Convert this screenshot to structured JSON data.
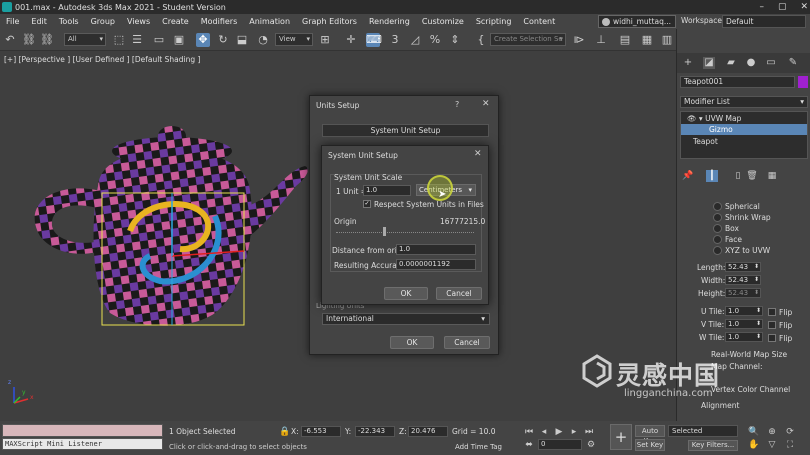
{
  "window": {
    "title": "001.max - Autodesk 3ds Max 2021 - Student Version",
    "controls": [
      "–",
      "▢",
      "✕"
    ]
  },
  "menu": {
    "items": [
      "File",
      "Edit",
      "Tools",
      "Group",
      "Views",
      "Create",
      "Modifiers",
      "Animation",
      "Graph Editors",
      "Rendering",
      "Customize",
      "Scripting",
      "Content"
    ],
    "user": "widhi_muttaq...",
    "workspaces_label": "Workspaces:",
    "workspace": "Default"
  },
  "toolbar": {
    "filter": "All",
    "ref_coord": "View",
    "named_selection": "Create Selection Se"
  },
  "viewport": {
    "label": "[+] [Perspective ] [User Defined ] [Default Shading ]",
    "axis_x": "x",
    "axis_y": "y",
    "axis_z": "z"
  },
  "command_panel": {
    "object_name": "Teapot001",
    "object_color": "#a020d0",
    "modifier_list": "Modifier List",
    "stack": [
      {
        "label": "UVW Map",
        "selected": false
      },
      {
        "label": "Gizmo",
        "selected": true
      },
      {
        "label": "Teapot",
        "selected": false
      }
    ],
    "mapping_options": [
      "Spherical",
      "Shrink Wrap",
      "Box",
      "Face",
      "XYZ to UVW"
    ],
    "length_label": "Length:",
    "length": "52.43",
    "width_label": "Width:",
    "width": "52.43",
    "height_label": "Height:",
    "height": "52.43",
    "utile_label": "U Tile:",
    "utile": "1.0",
    "vtile_label": "V Tile:",
    "vtile": "1.0",
    "wtile_label": "W Tile:",
    "wtile": "1.0",
    "flip": "Flip",
    "real_world": "Real-World Map Size",
    "map_channel": "Map Channel:",
    "vertex_color": "Vertex Color Channel",
    "alignment": "Alignment"
  },
  "units_setup": {
    "title": "Units Setup",
    "help": "?",
    "close": "✕",
    "system_unit_setup_button": "System Unit Setup",
    "lighting_label": "Lighting Units",
    "lighting_value": "International",
    "ok": "OK",
    "cancel": "Cancel"
  },
  "system_unit_setup": {
    "title": "System Unit Setup",
    "close": "✕",
    "scale_label": "System Unit Scale",
    "unit_label": "1 Unit =",
    "unit_value": "1.0",
    "unit_type": "Centimeters",
    "respect_label": "Respect System Units in Files",
    "respect_checked": "✓",
    "origin_label": "Origin",
    "origin_value": "16777215.0",
    "distance_label": "Distance from origin:",
    "distance_value": "1.0",
    "accuracy_label": "Resulting Accuracy:",
    "accuracy_value": "0.0000001192",
    "ok": "OK",
    "cancel": "Cancel"
  },
  "status": {
    "maxscript": "MAXScript Mini Listener",
    "selected": "1 Object Selected",
    "prompt": "Click or click-and-drag to select objects",
    "x_label": "X:",
    "x": "-6.553",
    "y_label": "Y:",
    "y": "-22.343",
    "z_label": "Z:",
    "z": "20.476",
    "grid": "Grid = 10.0",
    "add_time_tag": "Add Time Tag",
    "frame": "0",
    "auto_key": "Auto Key",
    "set_key": "Set Key",
    "selected_dd": "Selected",
    "key_filters": "Key Filters..."
  },
  "watermark": {
    "cn": "灵感中国",
    "en": "lingganchina.com"
  }
}
